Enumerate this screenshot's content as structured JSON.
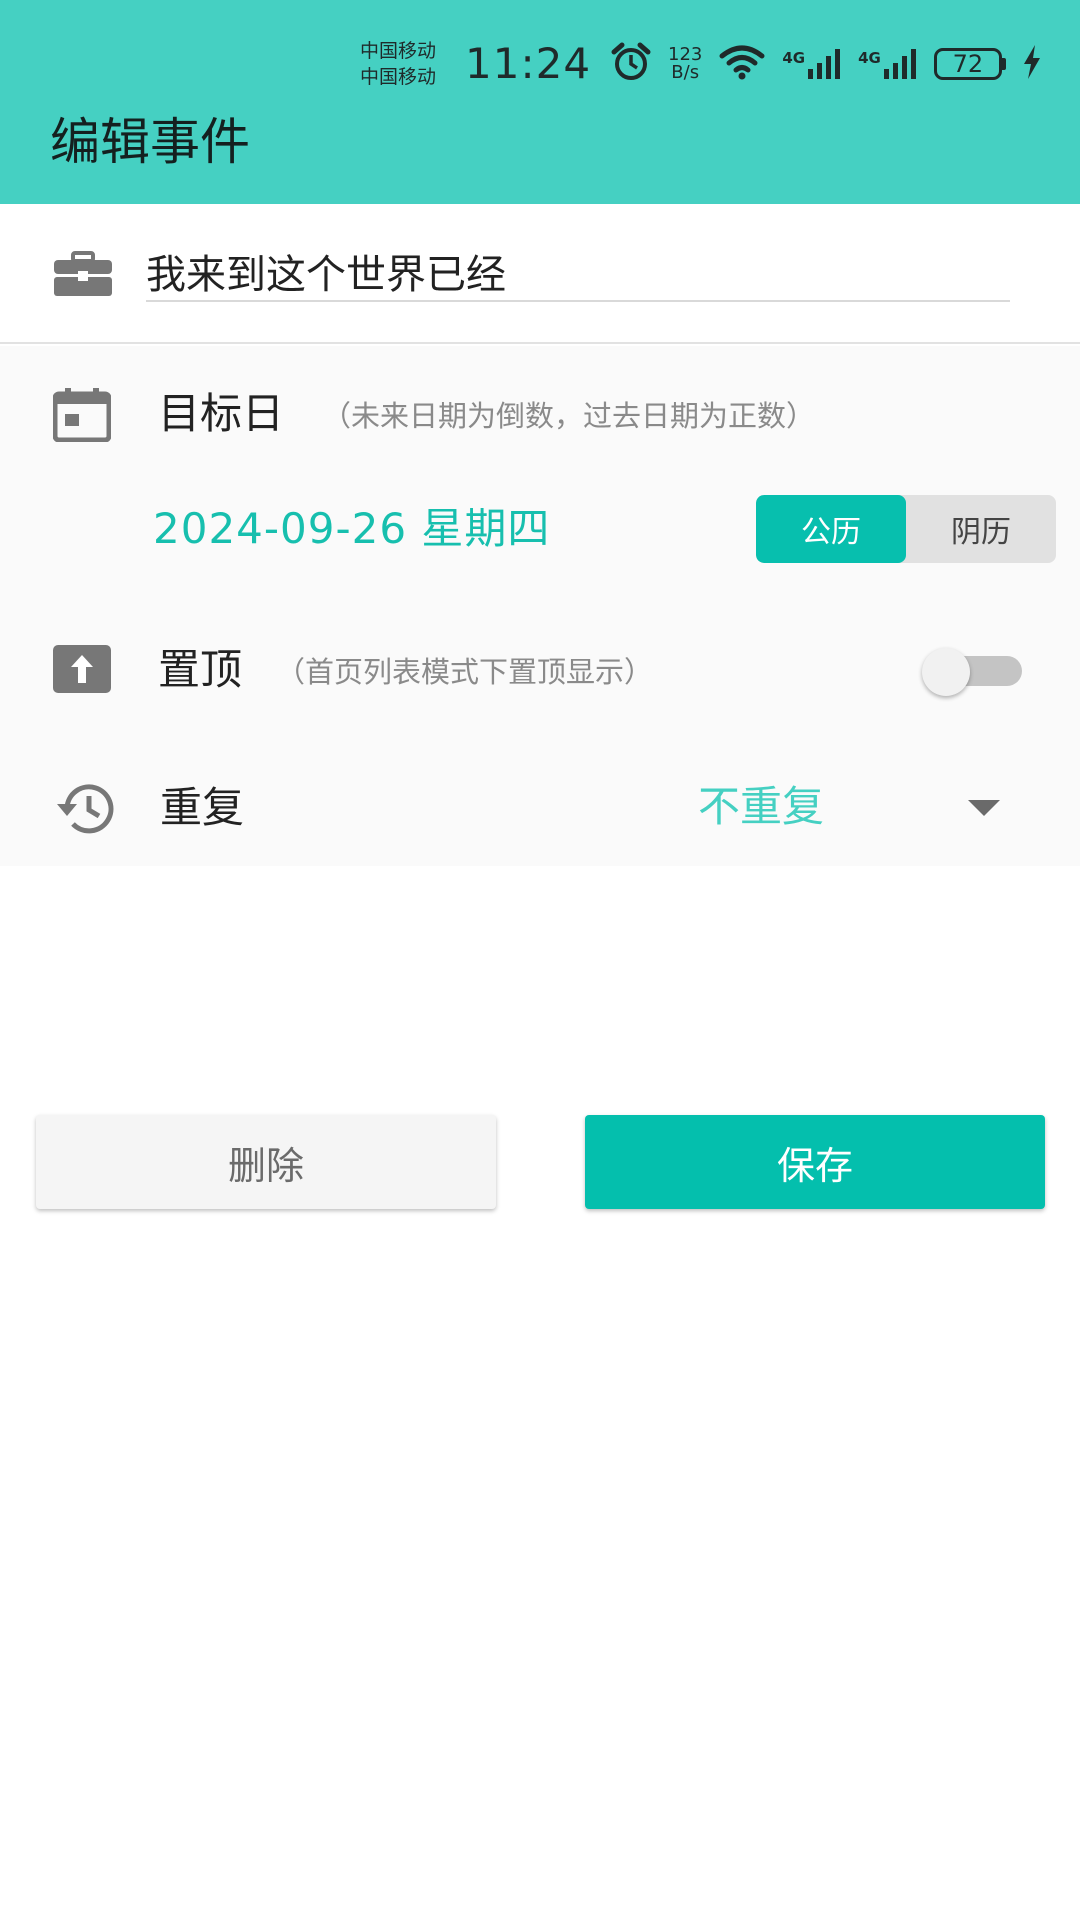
{
  "status_bar": {
    "carrier_1": "中国移动",
    "carrier_2": "中国移动",
    "time": "11:24",
    "net_speed_value": "123",
    "net_speed_unit": "B/s",
    "signal_1": "4G",
    "signal_2": "4G",
    "battery": "72",
    "icons": [
      "alarm-icon",
      "wifi-icon",
      "signal-4g-icon",
      "signal-4g-icon",
      "battery-icon",
      "charging-icon"
    ]
  },
  "header": {
    "title": "编辑事件"
  },
  "event": {
    "icon": "briefcase-icon",
    "title_value": "我来到这个世界已经"
  },
  "target_date": {
    "icon": "calendar-icon",
    "label": "目标日",
    "hint": "（未来日期为倒数，过去日期为正数）",
    "date_text": "2024-09-26 星期四",
    "calendar_options": [
      "公历",
      "阴历"
    ],
    "selected_calendar": "公历"
  },
  "pin_top": {
    "icon": "pin-top-icon",
    "label": "置顶",
    "hint": "（首页列表模式下置顶显示）",
    "enabled": false
  },
  "repeat": {
    "icon": "history-icon",
    "label": "重复",
    "value": "不重复"
  },
  "buttons": {
    "delete": "删除",
    "save": "保存"
  },
  "colors": {
    "header_bg": "#45d0c2",
    "accent": "#04bfad",
    "date_text": "#17bfae"
  }
}
